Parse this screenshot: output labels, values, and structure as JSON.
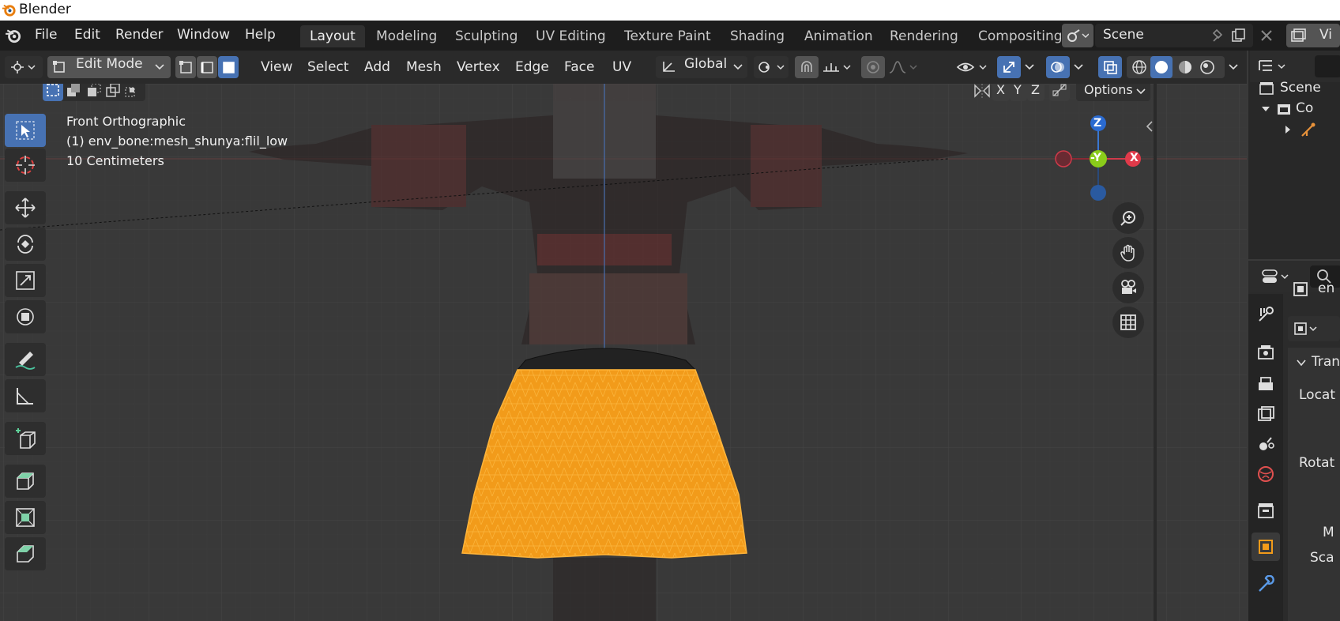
{
  "window": {
    "title": "Blender"
  },
  "menu": {
    "items": [
      "File",
      "Edit",
      "Render",
      "Window",
      "Help"
    ]
  },
  "workspaces": {
    "tabs": [
      "Layout",
      "Modeling",
      "Sculpting",
      "UV Editing",
      "Texture Paint",
      "Shading",
      "Animation",
      "Rendering",
      "Compositing"
    ],
    "active": "Layout"
  },
  "scene": {
    "name": "Scene",
    "view_layer_short": "Vi"
  },
  "header": {
    "mode": "Edit Mode",
    "menus": [
      "View",
      "Select",
      "Add",
      "Mesh",
      "Vertex",
      "Edge",
      "Face",
      "UV"
    ],
    "orientation": "Global",
    "axis_labels": [
      "X",
      "Y",
      "Z"
    ],
    "options_label": "Options"
  },
  "viewport": {
    "view_name": "Front Orthographic",
    "object_info": "(1) env_bone:mesh_shunya:flil_low",
    "scale": "10 Centimeters",
    "gizmo": {
      "z": "Z",
      "neg_y": "-Y",
      "x": "X"
    }
  },
  "outliner": {
    "root": "Scene",
    "collection_short": "Co"
  },
  "properties": {
    "object_name_short": "en",
    "panel_short": "Tran",
    "labels": [
      "Locat",
      "Rotat",
      "M",
      "Sca"
    ]
  },
  "colors": {
    "accent": "#4772b3",
    "selection": "#f5a623",
    "background": "#393939"
  }
}
